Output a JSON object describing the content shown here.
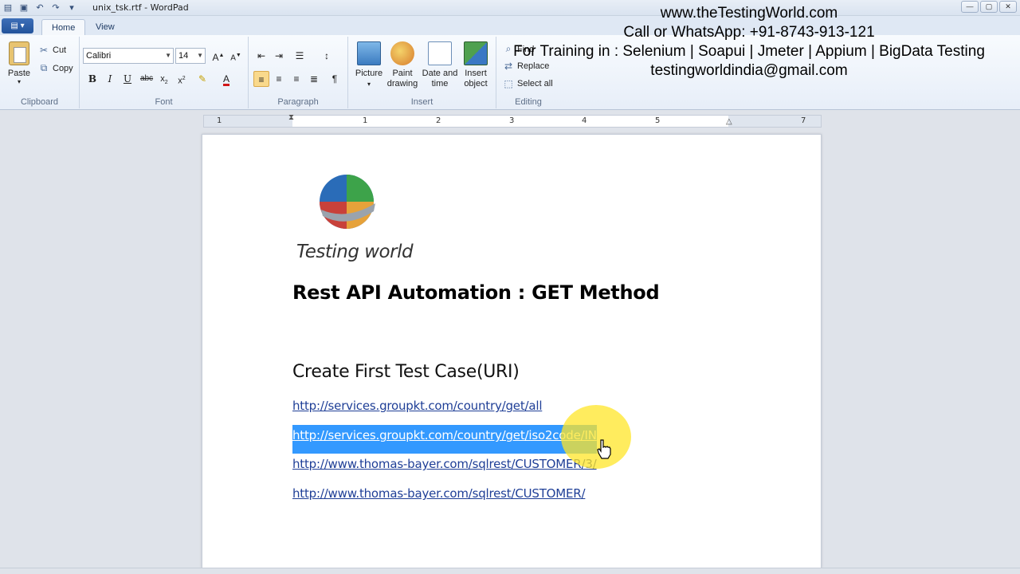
{
  "window": {
    "title": "unix_tsk.rtf - WordPad"
  },
  "tabs": [
    {
      "label": "Home"
    },
    {
      "label": "View"
    }
  ],
  "ribbon": {
    "clipboard": {
      "paste": "Paste",
      "cut": "Cut",
      "copy": "Copy",
      "label": "Clipboard"
    },
    "font": {
      "family": "Calibri",
      "size": "14",
      "label": "Font"
    },
    "paragraph": {
      "label": "Paragraph"
    },
    "insert": {
      "picture": "Picture",
      "paint_drawing": "Paint drawing",
      "date_time": "Date and time",
      "insert_object": "Insert object",
      "label": "Insert"
    },
    "editing": {
      "find": "Find",
      "replace": "Replace",
      "select_all": "Select all",
      "label": "Editing"
    }
  },
  "watermark": {
    "line1": "www.theTestingWorld.com",
    "line2": "Call or WhatsApp: +91-8743-913-121",
    "line3": "For Training in : Selenium | Soapui | Jmeter | Appium | BigData Testing",
    "line4": "testingworldindia@gmail.com"
  },
  "ruler": {
    "labels": [
      "1",
      "1",
      "2",
      "3",
      "4",
      "5",
      "7"
    ]
  },
  "document": {
    "logo_text": "Testing world",
    "heading": "Rest API Automation :  GET Method",
    "subheading": "Create First Test Case(URI)",
    "links": [
      "http://services.groupkt.com/country/get/all",
      "http://services.groupkt.com/country/get/iso2code/IN",
      "http://www.thomas-bayer.com/sqlrest/CUSTOMER/3/",
      "http://www.thomas-bayer.com/sqlrest/CUSTOMER/"
    ]
  },
  "colors": {
    "selection": "#3399ff",
    "link": "#1f3f97",
    "highlight": "#ffe628"
  }
}
